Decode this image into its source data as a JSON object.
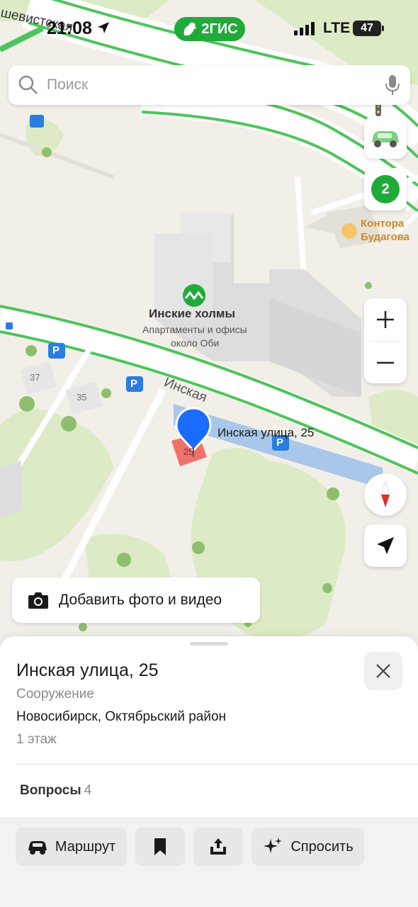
{
  "status_bar": {
    "time": "21:08",
    "brand": "2ГИС",
    "network": "LTE",
    "battery": "47"
  },
  "search": {
    "placeholder": "Поиск"
  },
  "map": {
    "street_top": "шевистская",
    "street_main": "Инская",
    "poi_building": "Инские холмы",
    "poi_building_sub_1": "Апартаменты и офисы",
    "poi_building_sub_2": "около Оби",
    "poi_office_1": "Контора",
    "poi_office_2": "Будагова",
    "house_37": "37",
    "house_35": "35",
    "house_25": "25",
    "selected_label": "Инская улица, 25",
    "parking": "P",
    "zoom_in": "+",
    "zoom_out": "−"
  },
  "controls": {
    "traffic_badge": "2",
    "add_photo_label": "Добавить фото и видео"
  },
  "place": {
    "title": "Инская улица, 25",
    "type": "Сооружение",
    "address": "Новосибирск, Октябрьский район",
    "floor": "1 этаж",
    "questions_label": "Вопросы",
    "questions_count": "4"
  },
  "actions": {
    "route": "Маршрут",
    "ask": "Спросить"
  },
  "colors": {
    "brand_green": "#1faa3a",
    "pin_blue": "#1a6cff",
    "building_red": "#f0716a",
    "road_green": "#4ec45c",
    "compass_red": "#e02b2b"
  }
}
